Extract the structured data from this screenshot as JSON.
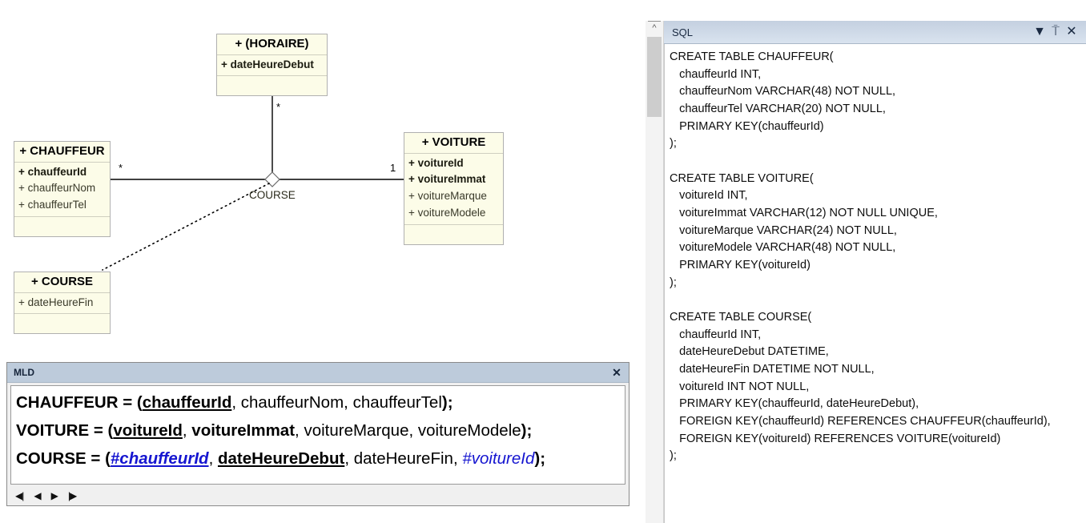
{
  "diagram": {
    "classes": [
      {
        "id": "horaire",
        "name": "+ (HORAIRE)",
        "attributes": [
          {
            "text": "+ dateHeureDebut",
            "key": true
          }
        ]
      },
      {
        "id": "chauffeur",
        "name": "+ CHAUFFEUR",
        "attributes": [
          {
            "text": "+ chauffeurId",
            "key": true
          },
          {
            "text": "+ chauffeurNom",
            "key": false
          },
          {
            "text": "+ chauffeurTel",
            "key": false
          }
        ]
      },
      {
        "id": "voiture",
        "name": "+ VOITURE",
        "attributes": [
          {
            "text": "+ voitureId",
            "key": true
          },
          {
            "text": "+ voitureImmat",
            "key": true
          },
          {
            "text": "+ voitureMarque",
            "key": false
          },
          {
            "text": "+ voitureModele",
            "key": false
          }
        ]
      },
      {
        "id": "course",
        "name": "+ COURSE",
        "attributes": [
          {
            "text": "+ dateHeureFin",
            "key": false
          }
        ]
      }
    ],
    "association": {
      "name": "COURSE",
      "multiplicity_chauffeur": "*",
      "multiplicity_horaire": "*",
      "multiplicity_voiture": "1"
    },
    "colors": {
      "class_fill": "#fcfce8",
      "class_border": "#b0b0b0",
      "line": "#000000"
    }
  },
  "mld": {
    "title": "MLD",
    "close_label": "✕",
    "lines": [
      {
        "segments": [
          {
            "text": "CHAUFFEUR = (",
            "style": "tbl"
          },
          {
            "text": "chauffeurId",
            "style": "pk"
          },
          {
            "text": ", ",
            "style": "pl"
          },
          {
            "text": "chauffeurNom",
            "style": "pl"
          },
          {
            "text": ", ",
            "style": "pl"
          },
          {
            "text": "chauffeurTel",
            "style": "pl"
          },
          {
            "text": ");",
            "style": "tbl"
          }
        ]
      },
      {
        "segments": [
          {
            "text": "VOITURE = (",
            "style": "tbl"
          },
          {
            "text": "voitureId",
            "style": "pk"
          },
          {
            "text": ", ",
            "style": "pl"
          },
          {
            "text": "voitureImmat",
            "style": "ak"
          },
          {
            "text": ", ",
            "style": "pl"
          },
          {
            "text": "voitureMarque",
            "style": "pl"
          },
          {
            "text": ", ",
            "style": "pl"
          },
          {
            "text": "voitureModele",
            "style": "pl"
          },
          {
            "text": ");",
            "style": "tbl"
          }
        ]
      },
      {
        "segments": [
          {
            "text": "COURSE = (",
            "style": "tbl"
          },
          {
            "text": "#chauffeurId",
            "style": "fkpk"
          },
          {
            "text": ", ",
            "style": "pl"
          },
          {
            "text": "dateHeureDebut",
            "style": "pk"
          },
          {
            "text": ", ",
            "style": "pl"
          },
          {
            "text": "dateHeureFin",
            "style": "pl"
          },
          {
            "text": ", ",
            "style": "pl"
          },
          {
            "text": "#voitureId",
            "style": "fk"
          },
          {
            "text": ");",
            "style": "tbl"
          }
        ]
      }
    ],
    "nav": [
      {
        "name": "first",
        "glyph": "◀|"
      },
      {
        "name": "previous",
        "glyph": "◀"
      },
      {
        "name": "next",
        "glyph": "▶"
      },
      {
        "name": "last",
        "glyph": "|▶"
      }
    ]
  },
  "sql": {
    "title": "SQL",
    "tools": [
      {
        "name": "dropdown",
        "glyph": "▼"
      },
      {
        "name": "pin",
        "glyph": "⍑"
      },
      {
        "name": "close",
        "glyph": "✕"
      }
    ],
    "lines": [
      "CREATE TABLE CHAUFFEUR(",
      "   chauffeurId INT,",
      "   chauffeurNom VARCHAR(48) NOT NULL,",
      "   chauffeurTel VARCHAR(20) NOT NULL,",
      "   PRIMARY KEY(chauffeurId)",
      ");",
      "",
      "CREATE TABLE VOITURE(",
      "   voitureId INT,",
      "   voitureImmat VARCHAR(12) NOT NULL UNIQUE,",
      "   voitureMarque VARCHAR(24) NOT NULL,",
      "   voitureModele VARCHAR(48) NOT NULL,",
      "   PRIMARY KEY(voitureId)",
      ");",
      "",
      "CREATE TABLE COURSE(",
      "   chauffeurId INT,",
      "   dateHeureDebut DATETIME,",
      "   dateHeureFin DATETIME NOT NULL,",
      "   voitureId INT NOT NULL,",
      "   PRIMARY KEY(chauffeurId, dateHeureDebut),",
      "   FOREIGN KEY(chauffeurId) REFERENCES CHAUFFEUR(chauffeurId),",
      "   FOREIGN KEY(voitureId) REFERENCES VOITURE(voitureId)",
      ");"
    ]
  }
}
